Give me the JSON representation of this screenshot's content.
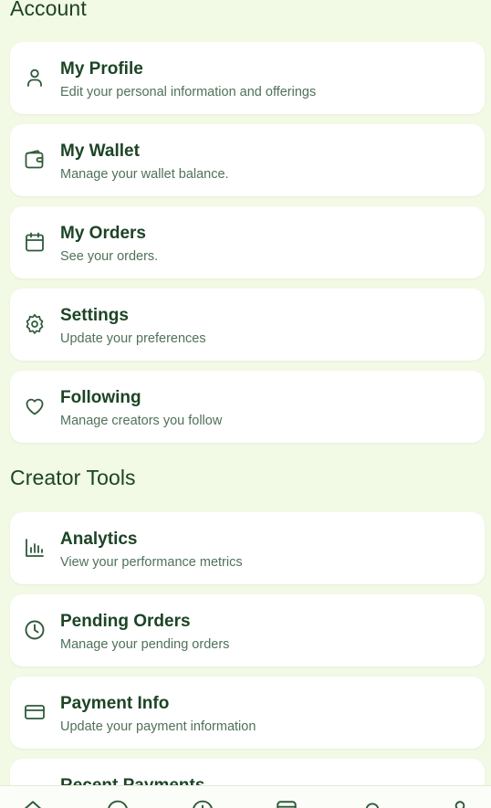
{
  "colors": {
    "background": "#f2f9e4",
    "card": "#ffffff",
    "heading": "#1c4425",
    "subtext": "#4f7258",
    "icon": "#2f5a3a"
  },
  "sections": [
    {
      "title": "Account",
      "items": [
        {
          "label": "My Profile",
          "description": "Edit your personal information and offerings",
          "icon": "user-icon"
        },
        {
          "label": "My Wallet",
          "description": "Manage your wallet balance.",
          "icon": "wallet-icon"
        },
        {
          "label": "My Orders",
          "description": "See your orders.",
          "icon": "calendar-icon"
        },
        {
          "label": "Settings",
          "description": "Update your preferences",
          "icon": "gear-icon"
        },
        {
          "label": "Following",
          "description": "Manage creators you follow",
          "icon": "heart-icon"
        }
      ]
    },
    {
      "title": "Creator Tools",
      "items": [
        {
          "label": "Analytics",
          "description": "View your performance metrics",
          "icon": "bar-chart-icon"
        },
        {
          "label": "Pending Orders",
          "description": "Manage your pending orders",
          "icon": "clock-icon"
        },
        {
          "label": "Payment Info",
          "description": "Update your payment information",
          "icon": "credit-card-icon"
        },
        {
          "label": "Recent Payments",
          "description": "",
          "icon": "list-icon"
        }
      ]
    }
  ],
  "bottom_nav": [
    {
      "icon": "home-icon"
    },
    {
      "icon": "search-icon"
    },
    {
      "icon": "add-icon"
    },
    {
      "icon": "bag-icon"
    },
    {
      "icon": "notifications-icon"
    },
    {
      "icon": "profile-icon"
    }
  ]
}
